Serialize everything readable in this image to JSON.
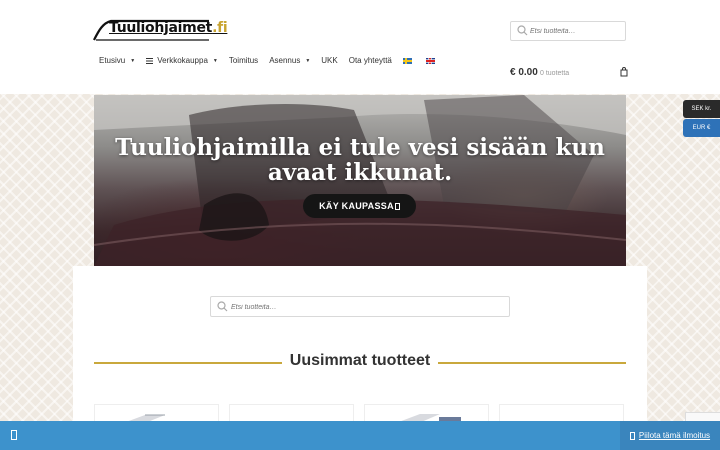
{
  "header": {
    "logo_text": "Tuuliohjaimet",
    "logo_tld": ".fi",
    "search_placeholder": "Etsi tuotteita…",
    "nav": {
      "etusivu": "Etusivu",
      "verkkokauppa": "Verkkokauppa",
      "toimitus": "Toimitus",
      "asennus": "Asennus",
      "ukk": "UKK",
      "ota_yhteytta": "Ota yhteyttä"
    },
    "cart_total": "€ 0.00",
    "cart_count": "0 tuotetta"
  },
  "hero": {
    "title": "Tuuliohjaimilla ei tule vesi sisään kun avaat ikkunat.",
    "button_label": "KÄY KAUPASSA"
  },
  "currency": {
    "sek": "SEK kr.",
    "eur": "EUR €"
  },
  "main": {
    "search_placeholder": "Etsi tuotteita…",
    "section_title": "Uusimmat tuotteet"
  },
  "notice": {
    "dismiss_label": "Piilota tämä ilmoitus"
  },
  "colors": {
    "accent_gold": "#c9a83c",
    "notice_blue": "#3d92cc",
    "currency_active": "#2e72b8"
  }
}
